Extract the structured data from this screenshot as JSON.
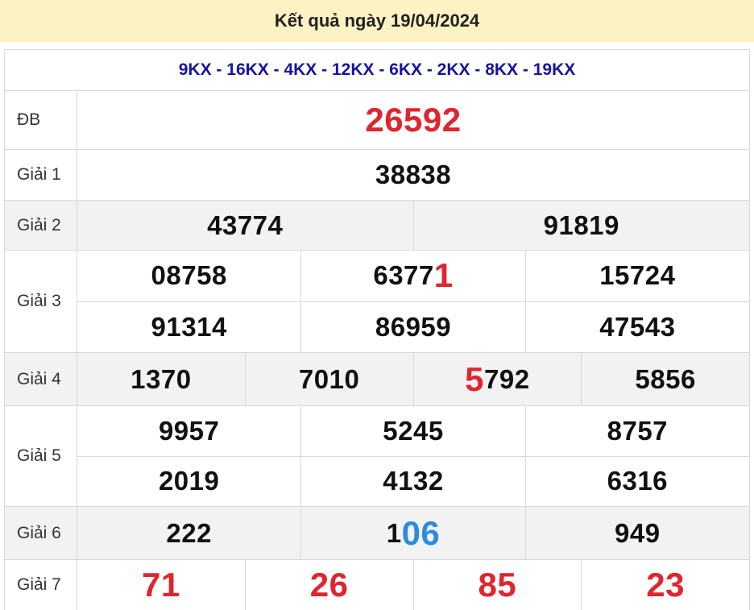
{
  "header": {
    "title": "Kết quả ngày 19/04/2024"
  },
  "codes": "9KX - 16KX - 4KX - 12KX - 6KX - 2KX - 8KX - 19KX",
  "prizes": {
    "db": {
      "label": "ĐB",
      "value": "26592"
    },
    "g1": {
      "label": "Giải 1",
      "values": [
        "38838"
      ]
    },
    "g2": {
      "label": "Giải 2",
      "values": [
        "43774",
        "91819"
      ]
    },
    "g3": {
      "label": "Giải 3",
      "values": [
        "08758",
        "6377",
        "1",
        "15724",
        "91314",
        "86959",
        "47543"
      ]
    },
    "g4": {
      "label": "Giải 4",
      "values": [
        "1370",
        "7010",
        "5",
        "792",
        "5856"
      ]
    },
    "g5": {
      "label": "Giải 5",
      "values": [
        "9957",
        "5245",
        "8757",
        "2019",
        "4132",
        "6316"
      ]
    },
    "g6": {
      "label": "Giải 6",
      "values": [
        "222",
        "1",
        "06",
        "949"
      ]
    },
    "g7": {
      "label": "Giải 7",
      "values": [
        "71",
        "26",
        "85",
        "23"
      ]
    }
  },
  "colors": {
    "header_bg": "#fdf2c4",
    "codes": "#1515a0",
    "highlight_red": "#e0252e",
    "highlight_blue": "#2b8be0"
  }
}
